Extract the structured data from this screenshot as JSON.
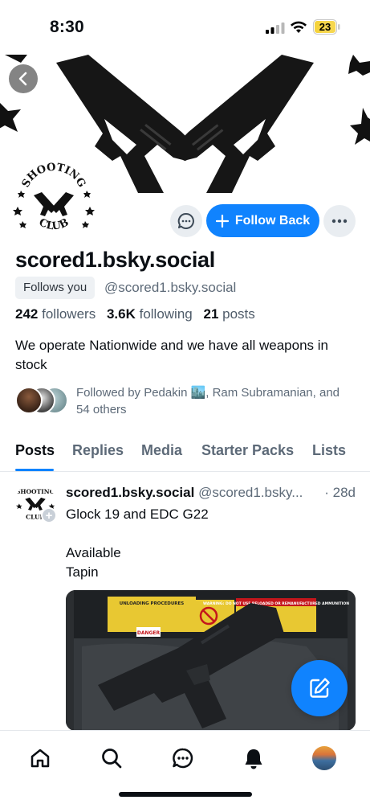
{
  "status_bar": {
    "time": "8:30",
    "battery": "23"
  },
  "profile": {
    "display_name": "scored1.bsky.social",
    "follows_you": "Follows you",
    "handle": "@scored1.bsky.social",
    "followers_count": "242",
    "followers_label": "followers",
    "following_count": "3.6K",
    "following_label": "following",
    "posts_count": "21",
    "posts_label": "posts",
    "bio": "We operate Nationwide and we have all weapons in stock",
    "followed_by": "Followed by Pedakin 🏙️, Ram Subramanian, and 54 others",
    "follow_button": "Follow Back"
  },
  "avatar_logo": {
    "top_text": "SHOOTING",
    "bottom_text": "CLUB"
  },
  "tabs": [
    {
      "label": "Posts"
    },
    {
      "label": "Replies"
    },
    {
      "label": "Media"
    },
    {
      "label": "Starter Packs"
    },
    {
      "label": "Lists"
    }
  ],
  "post": {
    "author_name": "scored1.bsky.social",
    "author_handle": "@scored1.bsky...",
    "time": "· 28d",
    "text": "Glock 19 and EDC G22\n\nAvailable\nTapin"
  },
  "post_image_labels": {
    "unloading": "UNLOADING PROCEDURES",
    "warning": "WARNING: DO NOT USE RELOADED OR REMANUFACTURED AMMUNITION",
    "danger": "DANGER"
  },
  "icons": {
    "back": "chevron-left-icon",
    "message": "chat-bubble-icon",
    "more": "ellipsis-icon",
    "compose": "compose-icon",
    "nav": [
      "home-icon",
      "search-icon",
      "chat-icon",
      "bell-icon",
      "profile-avatar"
    ]
  },
  "colors": {
    "accent": "#1083fe",
    "muted_text": "#5d6a78"
  }
}
